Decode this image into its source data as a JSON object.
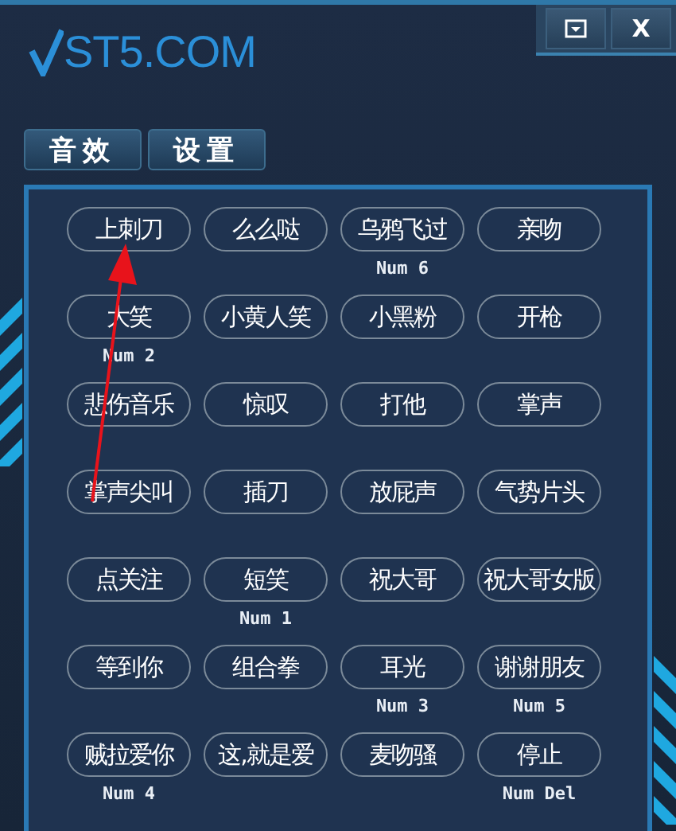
{
  "window": {
    "logo": "ST5.COM",
    "controls": [
      {
        "kind": "minimize"
      },
      {
        "kind": "close",
        "label": "X"
      }
    ]
  },
  "tabs": [
    {
      "label": "音效"
    },
    {
      "label": "设置"
    }
  ],
  "sounds": [
    {
      "label": "上刺刀"
    },
    {
      "label": "么么哒"
    },
    {
      "label": "乌鸦飞过",
      "hotkey": "Num 6"
    },
    {
      "label": "亲吻"
    },
    {
      "label": "大笑",
      "hotkey": "Num 2"
    },
    {
      "label": "小黄人笑"
    },
    {
      "label": "小黑粉"
    },
    {
      "label": "开枪"
    },
    {
      "label": "悲伤音乐"
    },
    {
      "label": "惊叹"
    },
    {
      "label": "打他"
    },
    {
      "label": "掌声"
    },
    {
      "label": "掌声尖叫"
    },
    {
      "label": "插刀"
    },
    {
      "label": "放屁声"
    },
    {
      "label": "气势片头"
    },
    {
      "label": "点关注"
    },
    {
      "label": "短笑",
      "hotkey": "Num 1"
    },
    {
      "label": "祝大哥"
    },
    {
      "label": "祝大哥女版"
    },
    {
      "label": "等到你"
    },
    {
      "label": "组合拳"
    },
    {
      "label": "耳光",
      "hotkey": "Num 3"
    },
    {
      "label": "谢谢朋友",
      "hotkey": "Num 5"
    },
    {
      "label": "贼拉爱你",
      "hotkey": "Num 4"
    },
    {
      "label": "这,就是爱"
    },
    {
      "label": "麦吻骚"
    },
    {
      "label": "停止",
      "hotkey": "Num Del"
    }
  ],
  "annotation": {
    "kind": "arrow"
  }
}
